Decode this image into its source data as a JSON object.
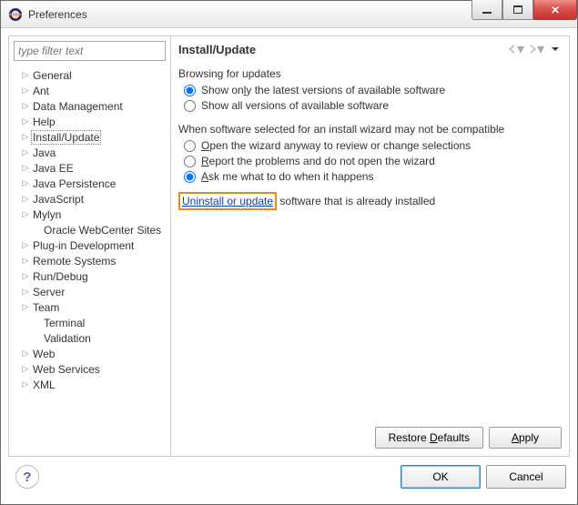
{
  "window": {
    "title": "Preferences"
  },
  "filter": {
    "placeholder": "type filter text"
  },
  "tree": {
    "items": [
      {
        "label": "General",
        "expandable": true
      },
      {
        "label": "Ant",
        "expandable": true
      },
      {
        "label": "Data Management",
        "expandable": true
      },
      {
        "label": "Help",
        "expandable": true
      },
      {
        "label": "Install/Update",
        "expandable": true,
        "selected": true
      },
      {
        "label": "Java",
        "expandable": true
      },
      {
        "label": "Java EE",
        "expandable": true
      },
      {
        "label": "Java Persistence",
        "expandable": true
      },
      {
        "label": "JavaScript",
        "expandable": true
      },
      {
        "label": "Mylyn",
        "expandable": true
      },
      {
        "label": "Oracle WebCenter Sites",
        "expandable": false,
        "indent": true
      },
      {
        "label": "Plug-in Development",
        "expandable": true
      },
      {
        "label": "Remote Systems",
        "expandable": true
      },
      {
        "label": "Run/Debug",
        "expandable": true
      },
      {
        "label": "Server",
        "expandable": true
      },
      {
        "label": "Team",
        "expandable": true
      },
      {
        "label": "Terminal",
        "expandable": false,
        "indent": true
      },
      {
        "label": "Validation",
        "expandable": false,
        "indent": true
      },
      {
        "label": "Web",
        "expandable": true
      },
      {
        "label": "Web Services",
        "expandable": true
      },
      {
        "label": "XML",
        "expandable": true
      }
    ]
  },
  "page": {
    "title": "Install/Update",
    "browsing_group": "Browsing for updates",
    "browsing_opt1": "Show only the latest versions of available software",
    "browsing_opt2": "Show all versions of available software",
    "compat_group": "When software selected for an install wizard may not be compatible",
    "compat_opt1": "Open the wizard anyway to review or change selections",
    "compat_opt2": "Report the problems and do not open the wizard",
    "compat_opt3": "Ask me what to do when it happens",
    "link_text": "Uninstall or update",
    "link_suffix": " software that is already installed"
  },
  "buttons": {
    "restore_defaults": "Restore Defaults",
    "apply": "Apply",
    "ok": "OK",
    "cancel": "Cancel"
  }
}
